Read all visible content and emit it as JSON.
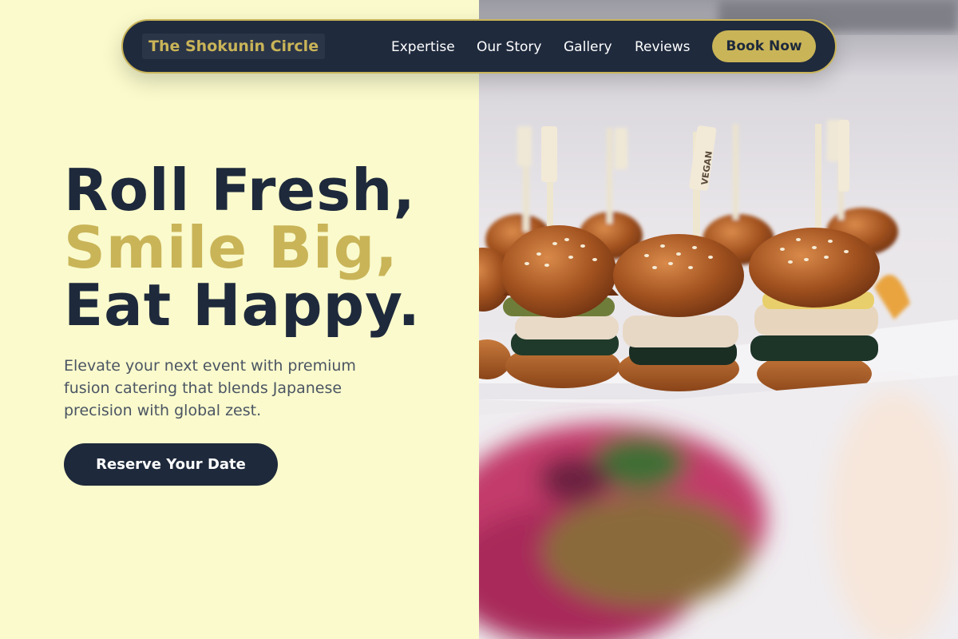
{
  "navbar": {
    "brand": "The Shokunin Circle",
    "links": [
      "Expertise",
      "Our Story",
      "Gallery",
      "Reviews"
    ],
    "cta": "Book Now"
  },
  "hero": {
    "title_lines": [
      "Roll Fresh,",
      "Smile Big,",
      "Eat Happy."
    ],
    "subtitle": "Elevate your next event with premium fusion catering that blends Japanese precision with global zest.",
    "cta": "Reserve Your Date"
  },
  "photo": {
    "pick_label": "VEGAN"
  },
  "colors": {
    "left_background": "#fafacc",
    "navy": "#1e293b",
    "gold": "#c9b458"
  }
}
